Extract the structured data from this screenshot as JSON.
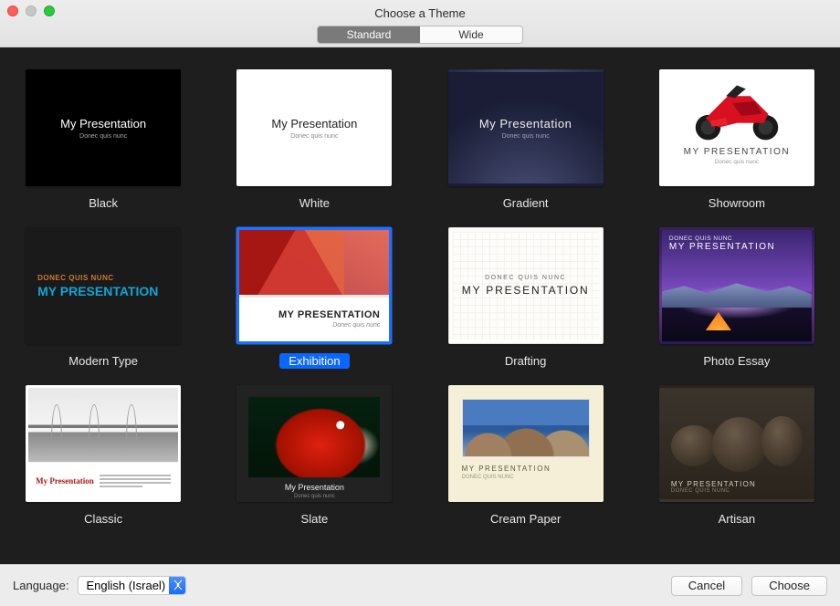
{
  "window": {
    "title": "Choose a Theme"
  },
  "tabs": {
    "standard": "Standard",
    "wide": "Wide",
    "active": "Standard"
  },
  "thumb_text": {
    "my_presentation": "My Presentation",
    "my_presentation_upper": "MY PRESENTATION",
    "donec_lower": "Donec quis nunc",
    "donec_upper": "DONEC QUIS NUNC"
  },
  "themes": [
    {
      "id": "black",
      "label": "Black"
    },
    {
      "id": "white",
      "label": "White"
    },
    {
      "id": "gradient",
      "label": "Gradient"
    },
    {
      "id": "showroom",
      "label": "Showroom"
    },
    {
      "id": "modern",
      "label": "Modern Type"
    },
    {
      "id": "exhibition",
      "label": "Exhibition"
    },
    {
      "id": "drafting",
      "label": "Drafting"
    },
    {
      "id": "photo",
      "label": "Photo Essay"
    },
    {
      "id": "classic",
      "label": "Classic"
    },
    {
      "id": "slate",
      "label": "Slate"
    },
    {
      "id": "cream",
      "label": "Cream Paper"
    },
    {
      "id": "artisan",
      "label": "Artisan"
    }
  ],
  "selected_theme": "exhibition",
  "footer": {
    "language_label": "Language:",
    "language_value": "English (Israel)",
    "cancel": "Cancel",
    "choose": "Choose"
  }
}
